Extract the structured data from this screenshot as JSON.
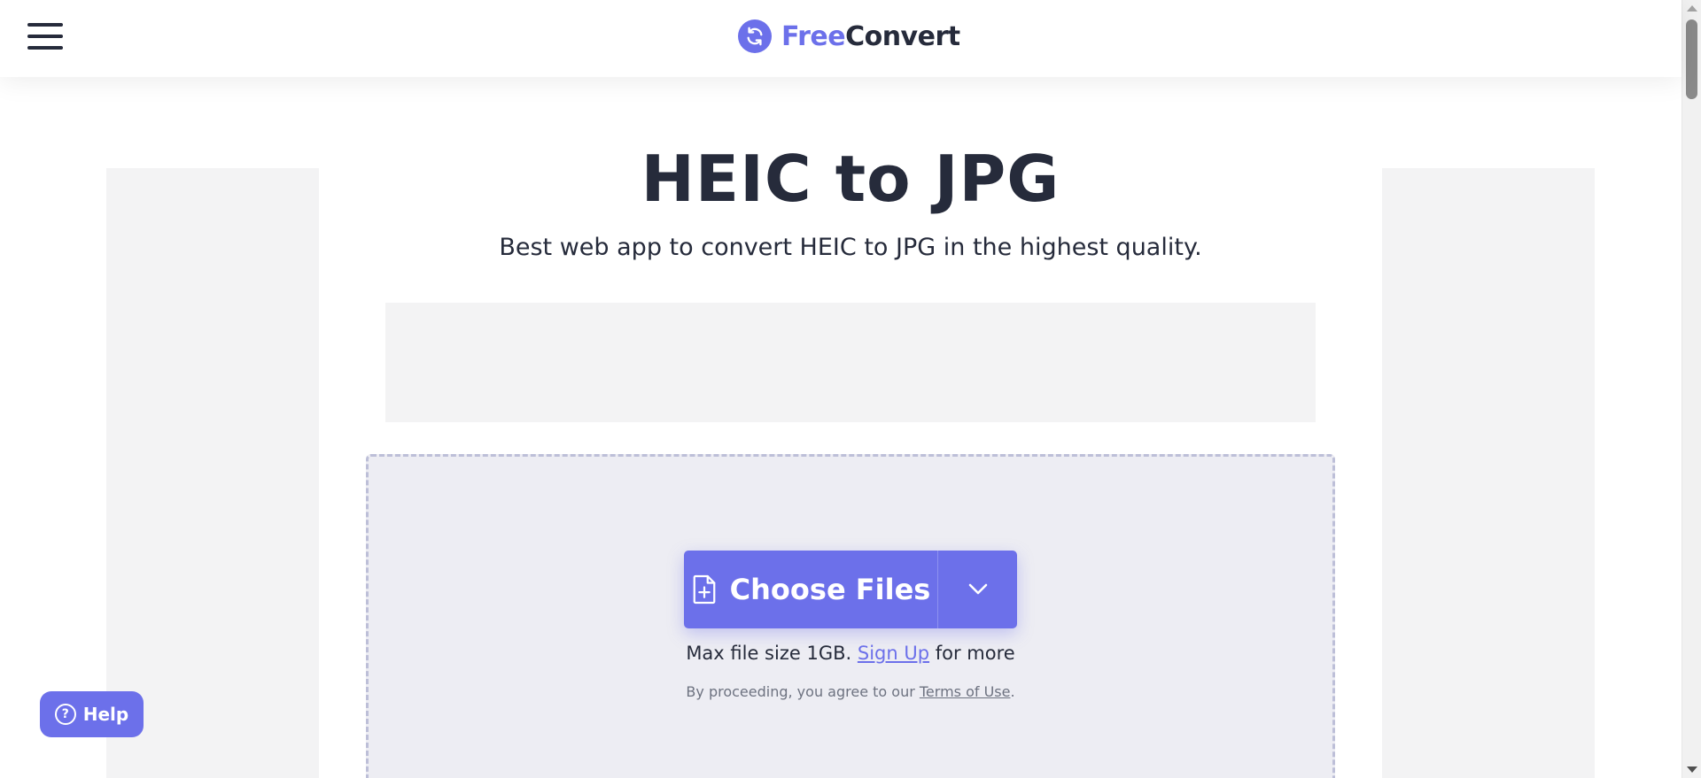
{
  "header": {
    "logo_free": "Free",
    "logo_convert": "Convert",
    "menu_icon": "hamburger-menu-icon",
    "logo_icon": "refresh-arrows-icon"
  },
  "main": {
    "title": "HEIC to JPG",
    "subtitle": "Best web app to convert HEIC to JPG in the highest quality.",
    "choose_files_label": "Choose Files",
    "choose_files_icon": "file-plus-icon",
    "dropdown_icon": "chevron-down-icon",
    "max_size_prefix": "Max file size 1GB.",
    "sign_up_label": "Sign Up",
    "max_size_suffix": "for more",
    "terms_prefix": "By proceeding, you agree to our",
    "terms_link": "Terms of Use",
    "terms_suffix": "."
  },
  "help": {
    "label": "Help",
    "icon": "question-circle-icon"
  },
  "colors": {
    "accent": "#6c70ea",
    "text": "#262b3b",
    "dropzone_bg": "#ededf3"
  }
}
